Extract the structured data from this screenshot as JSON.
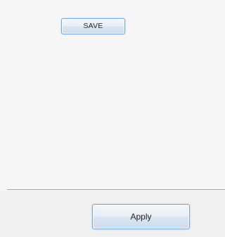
{
  "panel": {
    "save_label": "SAVE"
  },
  "footer": {
    "apply_label": "Apply"
  }
}
